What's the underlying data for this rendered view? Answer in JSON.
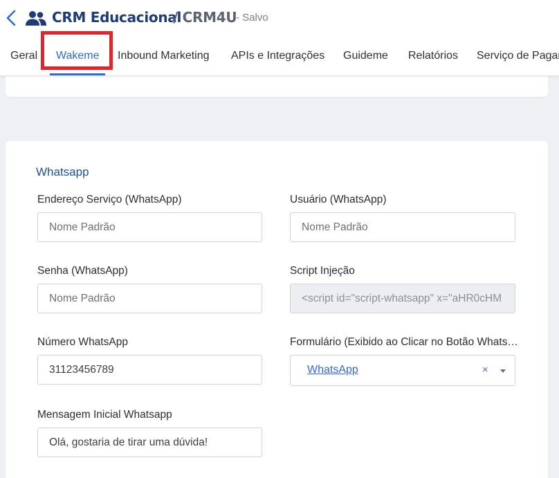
{
  "header": {
    "app_title": "CRM Educacional",
    "breadcrumb": "/ CRM4U",
    "status": "- Salvo",
    "icons": {
      "back": "chevron-left-icon",
      "app": "people-icon"
    },
    "accent_color": "#2f6ad6"
  },
  "tabs": [
    {
      "label": "Geral"
    },
    {
      "label": "Wakeme",
      "active": true
    },
    {
      "label": "Inbound Marketing"
    },
    {
      "label": "APIs e Integrações"
    },
    {
      "label": "Guideme"
    },
    {
      "label": "Relatórios"
    },
    {
      "label": "Serviço de Pagamento"
    }
  ],
  "whatsapp": {
    "section_title": "Whatsapp",
    "endereco": {
      "label": "Endereço Serviço (WhatsApp)",
      "placeholder": "Nome Padrão"
    },
    "usuario": {
      "label": "Usuário (WhatsApp)",
      "placeholder": "Nome Padrão"
    },
    "senha": {
      "label": "Senha (WhatsApp)",
      "placeholder": "Nome Padrão"
    },
    "script": {
      "label": "Script Injeção",
      "value": "<script id=\"script-whatsapp\" x=\"aHR0cHM"
    },
    "numero": {
      "label": "Número WhatsApp",
      "value": "31123456789"
    },
    "formulario": {
      "label": "Formulário (Exibido ao Clicar no Botão WhatsApp)",
      "selected": "WhatsApp",
      "clear": "×"
    },
    "mensagem": {
      "label": "Mensagem Inicial Whatsapp",
      "value": "Olá, gostaria de tirar uma dúvida!"
    }
  }
}
